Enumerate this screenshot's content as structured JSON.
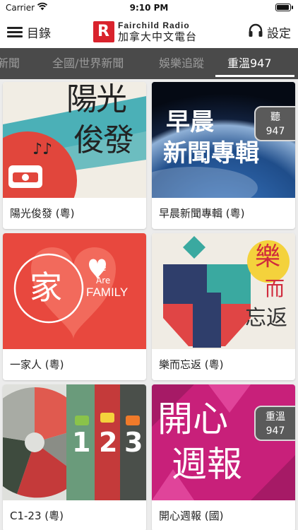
{
  "status": {
    "carrier": "Carrier",
    "time": "9:10 PM",
    "battery_level": 1.0
  },
  "header": {
    "menu_label": "目錄",
    "logo_en": "Fairchild Radio",
    "logo_zh": "加拿大中文電台",
    "settings_label": "設定"
  },
  "tabs": [
    {
      "label": "新聞"
    },
    {
      "label": "全國/世界新聞"
    },
    {
      "label": "娛樂追蹤"
    },
    {
      "label": "重溫947",
      "active": true
    }
  ],
  "programs": [
    {
      "title": "陽光俊發 (粵)",
      "art_text_1": "陽光",
      "art_text_2": "俊發"
    },
    {
      "title": "早晨新聞專輯 (粵)",
      "art_text_1": "早晨",
      "art_text_2": "新聞專輯",
      "badge_line1": "聽",
      "badge_line2": "947"
    },
    {
      "title": "一家人 (粵)",
      "art_text_1": "家",
      "art_text_2": "We",
      "art_text_3": "Are",
      "art_text_4": "FAMILY"
    },
    {
      "title": "樂而忘返 (粵)",
      "art_text_1": "樂",
      "art_text_2": "而",
      "art_text_3": "忘返"
    },
    {
      "title": "C1-23 (粵)",
      "art_text_1": "1",
      "art_text_2": "2",
      "art_text_3": "3"
    },
    {
      "title": "開心週報 (國)",
      "art_text_1": "開心",
      "art_text_2": "週報",
      "badge_line1": "重溫",
      "badge_line2": "947"
    }
  ]
}
